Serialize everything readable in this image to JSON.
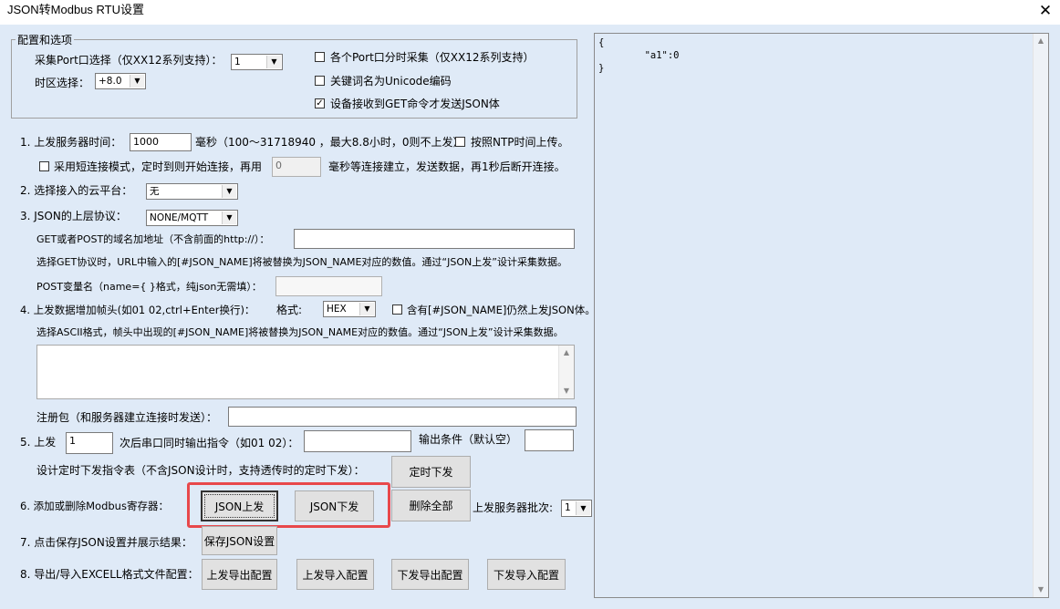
{
  "window": {
    "title": "JSON转Modbus RTU设置",
    "close": "✕"
  },
  "options": {
    "group_title": "配置和选项",
    "port_label": "采集Port口选择（仅XX12系列支持）：",
    "port_value": "1",
    "tz_label": "时区选择：",
    "tz_value": "+8.0",
    "cb_port_split": "各个Port口分时采集（仅XX12系列支持）",
    "cb_port_split_checked": false,
    "cb_unicode": "关键词名为Unicode编码",
    "cb_unicode_checked": false,
    "cb_get_cmd": "设备接收到GET命令才发送JSON体",
    "cb_get_cmd_checked": true
  },
  "row1": {
    "label": "1. 上发服务器时间：",
    "value": "1000",
    "hint": "毫秒（100～31718940 ，最大8.8小时，0则不上发）",
    "cb_ntp": "按照NTP时间上传。",
    "cb_ntp_checked": false,
    "cb_short": "采用短连接模式，定时到则开始连接，再用",
    "cb_short_checked": false,
    "short_value": "0",
    "short_hint": "毫秒等连接建立，发送数据，再1秒后断开连接。"
  },
  "row2": {
    "label": "2. 选择接入的云平台：",
    "value": "无"
  },
  "row3": {
    "label": "3. JSON的上层协议：",
    "value": "NONE/MQTT",
    "domain_label": "GET或者POST的域名加地址（不含前面的http://）：",
    "domain_value": "",
    "get_note": "选择GET协议时，URL中输入的[#JSON_NAME]将被替换为JSON_NAME对应的数值。通过“JSON上发”设计采集数据。",
    "post_label": "POST变量名（name={ }格式，纯json无需填）：",
    "post_value": ""
  },
  "row4": {
    "label": "4. 上发数据增加帧头(如01 02,ctrl+Enter换行)：",
    "format_label": "格式:",
    "format_value": "HEX",
    "cb_include": "含有[#JSON_NAME]仍然上发JSON体。",
    "cb_include_checked": false,
    "ascii_note": "选择ASCII格式，帧头中出现的[#JSON_NAME]将被替换为JSON_NAME对应的数值。通过“JSON上发”设计采集数据。",
    "header_value": "",
    "reg_label": "注册包（和服务器建立连接时发送）：",
    "reg_value": ""
  },
  "row5": {
    "label": "5. 上发",
    "value": "1",
    "mid": "次后串口同时输出指令（如01 02）：",
    "cmd_value": "",
    "cond_label": "输出条件（默认空）",
    "cond_value": "",
    "timer_label": "设计定时下发指令表（不含JSON设计时，支持透传时的定时下发）：",
    "timer_btn": "定时下发"
  },
  "row6": {
    "label": "6. 添加或删除Modbus寄存器：",
    "btn_up": "JSON上发",
    "btn_down": "JSON下发",
    "btn_delete": "删除全部",
    "batch_label": "上发服务器批次:",
    "batch_value": "1"
  },
  "row7": {
    "label": "7. 点击保存JSON设置并展示结果：",
    "btn_save": "保存JSON设置"
  },
  "row8": {
    "label": "8. 导出/导入EXCELL格式文件配置：",
    "btn_up_export": "上发导出配置",
    "btn_up_import": "上发导入配置",
    "btn_down_export": "下发导出配置",
    "btn_down_import": "下发导入配置"
  },
  "json_preview": {
    "text": "{\n        \"a1\":0\n}"
  },
  "colors": {
    "client_bg": "#dfeaf7",
    "highlight": "#e8484b"
  }
}
